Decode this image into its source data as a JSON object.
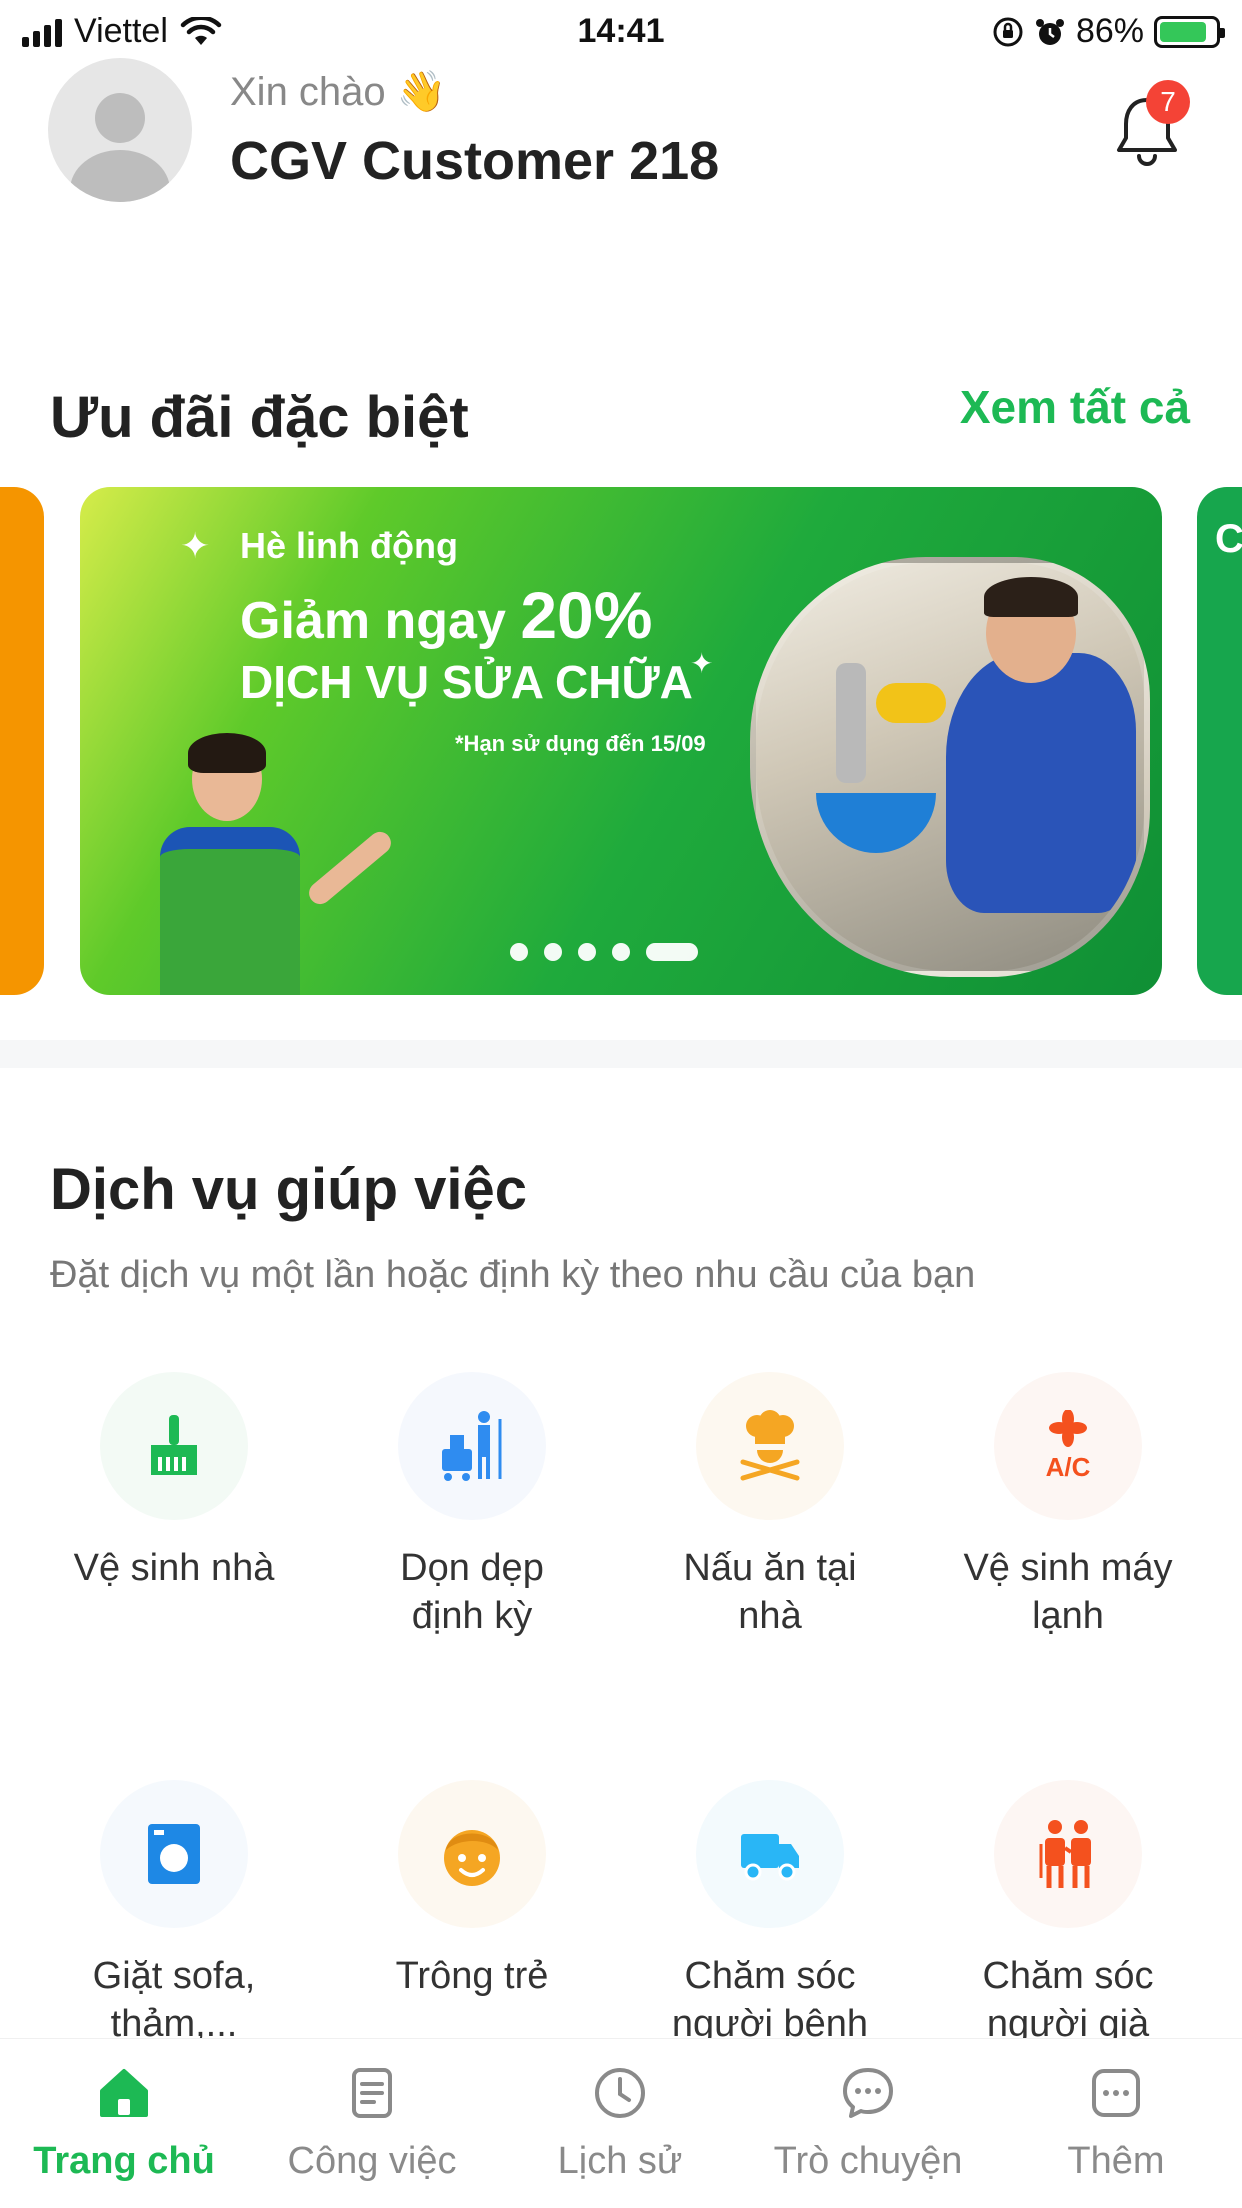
{
  "status_bar": {
    "carrier": "Viettel",
    "time": "14:41",
    "battery_percent": "86%",
    "battery_level": 0.86
  },
  "header": {
    "greeting": "Xin chào 👋",
    "username": "CGV Customer 218",
    "notification_count": "7"
  },
  "offers": {
    "title": "Ưu đãi đặc biệt",
    "see_all": "Xem tất cả",
    "banner": {
      "line1": "Hè linh động",
      "line2_prefix": "Giảm ngay ",
      "line2_value": "20%",
      "line3": "DỊCH VỤ SỬA CHỮA",
      "line4": "*Hạn sử dụng đến 15/09"
    },
    "right_card_letter": "C",
    "carousel_total": 5,
    "carousel_active": 5
  },
  "services": {
    "title": "Dịch vụ giúp việc",
    "subtitle": "Đặt dịch vụ một lần hoặc định kỳ theo nhu cầu của bạn",
    "items": [
      {
        "label_1": "Vệ sinh nhà",
        "label_2": "",
        "icon": "broom-icon",
        "color": "#1db954"
      },
      {
        "label_1": "Dọn dẹp",
        "label_2": "định kỳ",
        "icon": "cleaning-cart-icon",
        "color": "#2f8cf0"
      },
      {
        "label_1": "Nấu ăn tại",
        "label_2": "nhà",
        "icon": "chef-icon",
        "color": "#f5a623"
      },
      {
        "label_1": "Vệ sinh máy",
        "label_2": "lạnh",
        "icon": "air-conditioner-icon",
        "color": "#f4511e"
      },
      {
        "label_1": "Giặt sofa,",
        "label_2": "thảm,...",
        "icon": "washing-machine-icon",
        "color": "#1e88e5"
      },
      {
        "label_1": "Trông trẻ",
        "label_2": "",
        "icon": "child-face-icon",
        "color": "#f5a623"
      },
      {
        "label_1": "Chăm sóc",
        "label_2": "người bệnh",
        "icon": "ambulance-truck-icon",
        "color": "#29b6f6"
      },
      {
        "label_1": "Chăm sóc",
        "label_2": "người già",
        "icon": "elderly-care-icon",
        "color": "#f4511e"
      }
    ]
  },
  "bottom_nav": {
    "items": [
      {
        "label": "Trang chủ",
        "icon": "home-icon",
        "active": true
      },
      {
        "label": "Công việc",
        "icon": "document-icon",
        "active": false
      },
      {
        "label": "Lịch sử",
        "icon": "clock-icon",
        "active": false
      },
      {
        "label": "Trò chuyện",
        "icon": "chat-icon",
        "active": false
      },
      {
        "label": "Thêm",
        "icon": "more-icon",
        "active": false
      }
    ]
  },
  "colors": {
    "accent": "#1db954",
    "badge": "#f44336",
    "banner_green": "#1faa3c",
    "left_card": "#f59500"
  }
}
